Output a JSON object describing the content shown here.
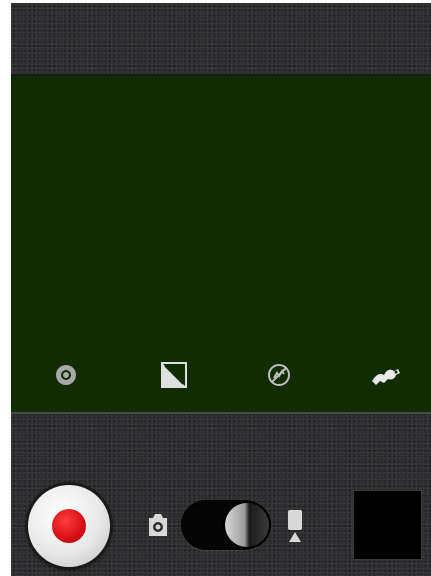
{
  "app": {
    "name": "",
    "mode": "video"
  },
  "viewfinder": {
    "background_color": "#102c00",
    "settings": [
      {
        "name": "settings-icon",
        "interactable": true
      },
      {
        "name": "exposure-icon",
        "interactable": true
      },
      {
        "name": "flash-off-icon",
        "interactable": true
      },
      {
        "name": "effects-icon",
        "interactable": true
      }
    ]
  },
  "controls": {
    "record_button_color": "#d60f16",
    "mode_switch": {
      "left_icon": "camera-icon",
      "right_icon": "video-camera-icon",
      "selected": "video"
    },
    "thumbnail": "last-capture-thumbnail"
  },
  "colors": {
    "panel": "#2b2b2d",
    "viewfinder": "#102c00",
    "record": "#d60f16",
    "icon": "#d8d8d8"
  }
}
